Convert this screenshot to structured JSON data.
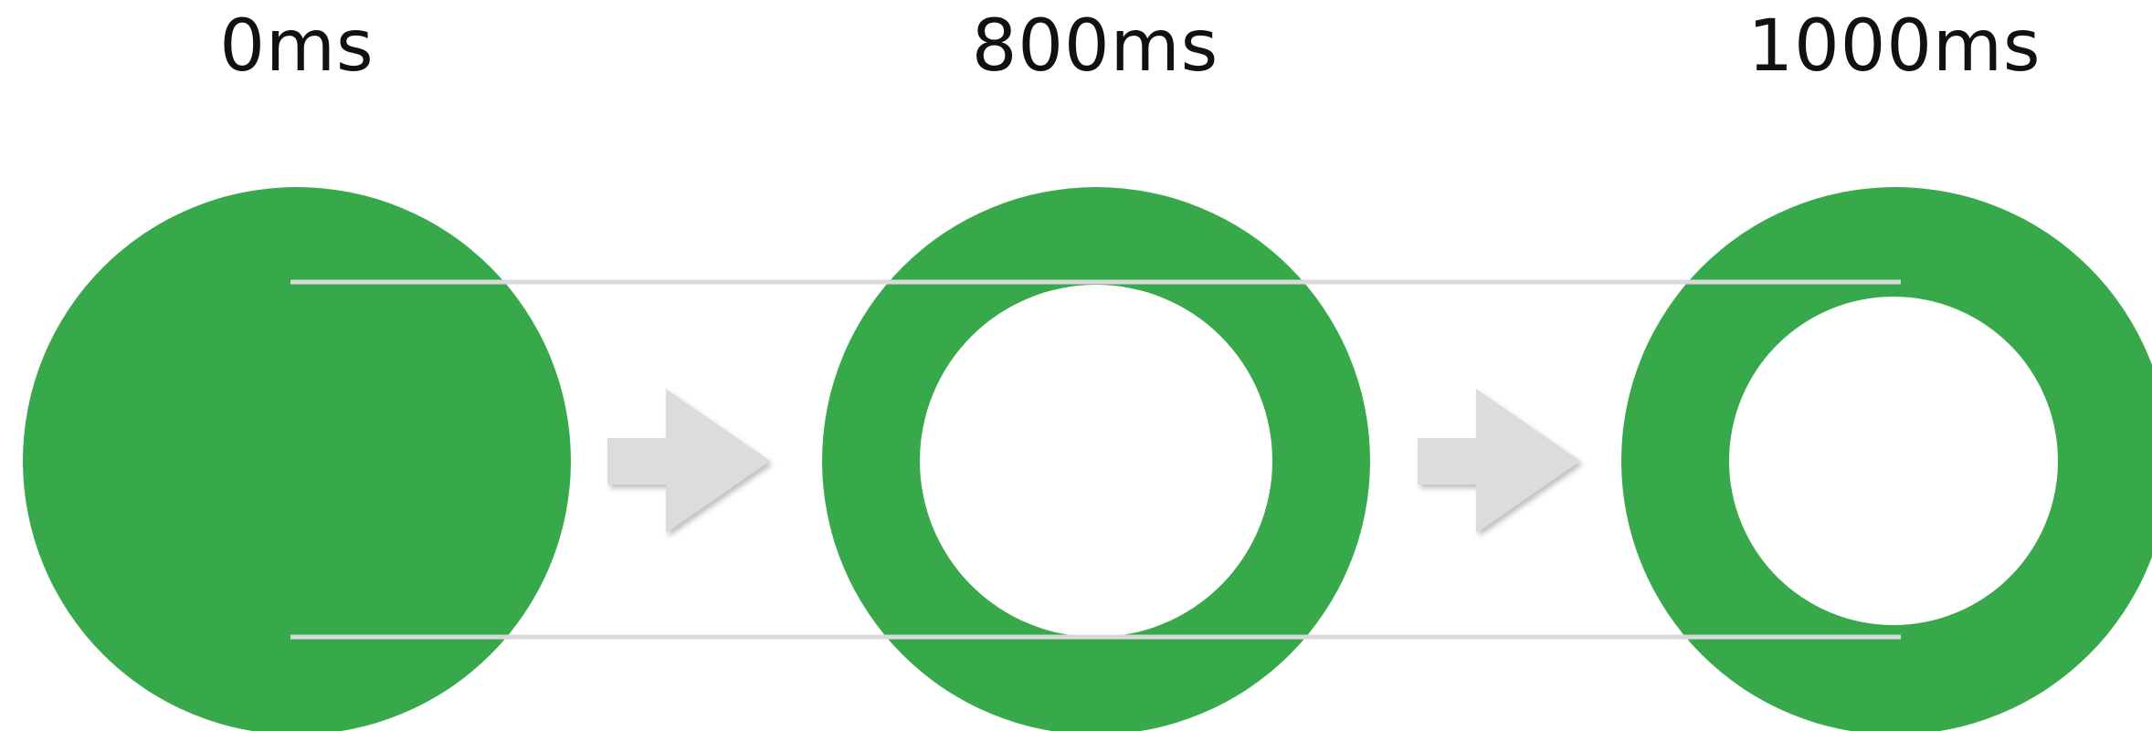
{
  "frames": [
    {
      "label": "0ms"
    },
    {
      "label": "800ms"
    },
    {
      "label": "1000ms"
    }
  ],
  "colors": {
    "ring": "#37a94b",
    "arrow": "#dcdcdf",
    "guide": "#d9d9d9",
    "text": "#111111",
    "background": "#ffffff"
  }
}
